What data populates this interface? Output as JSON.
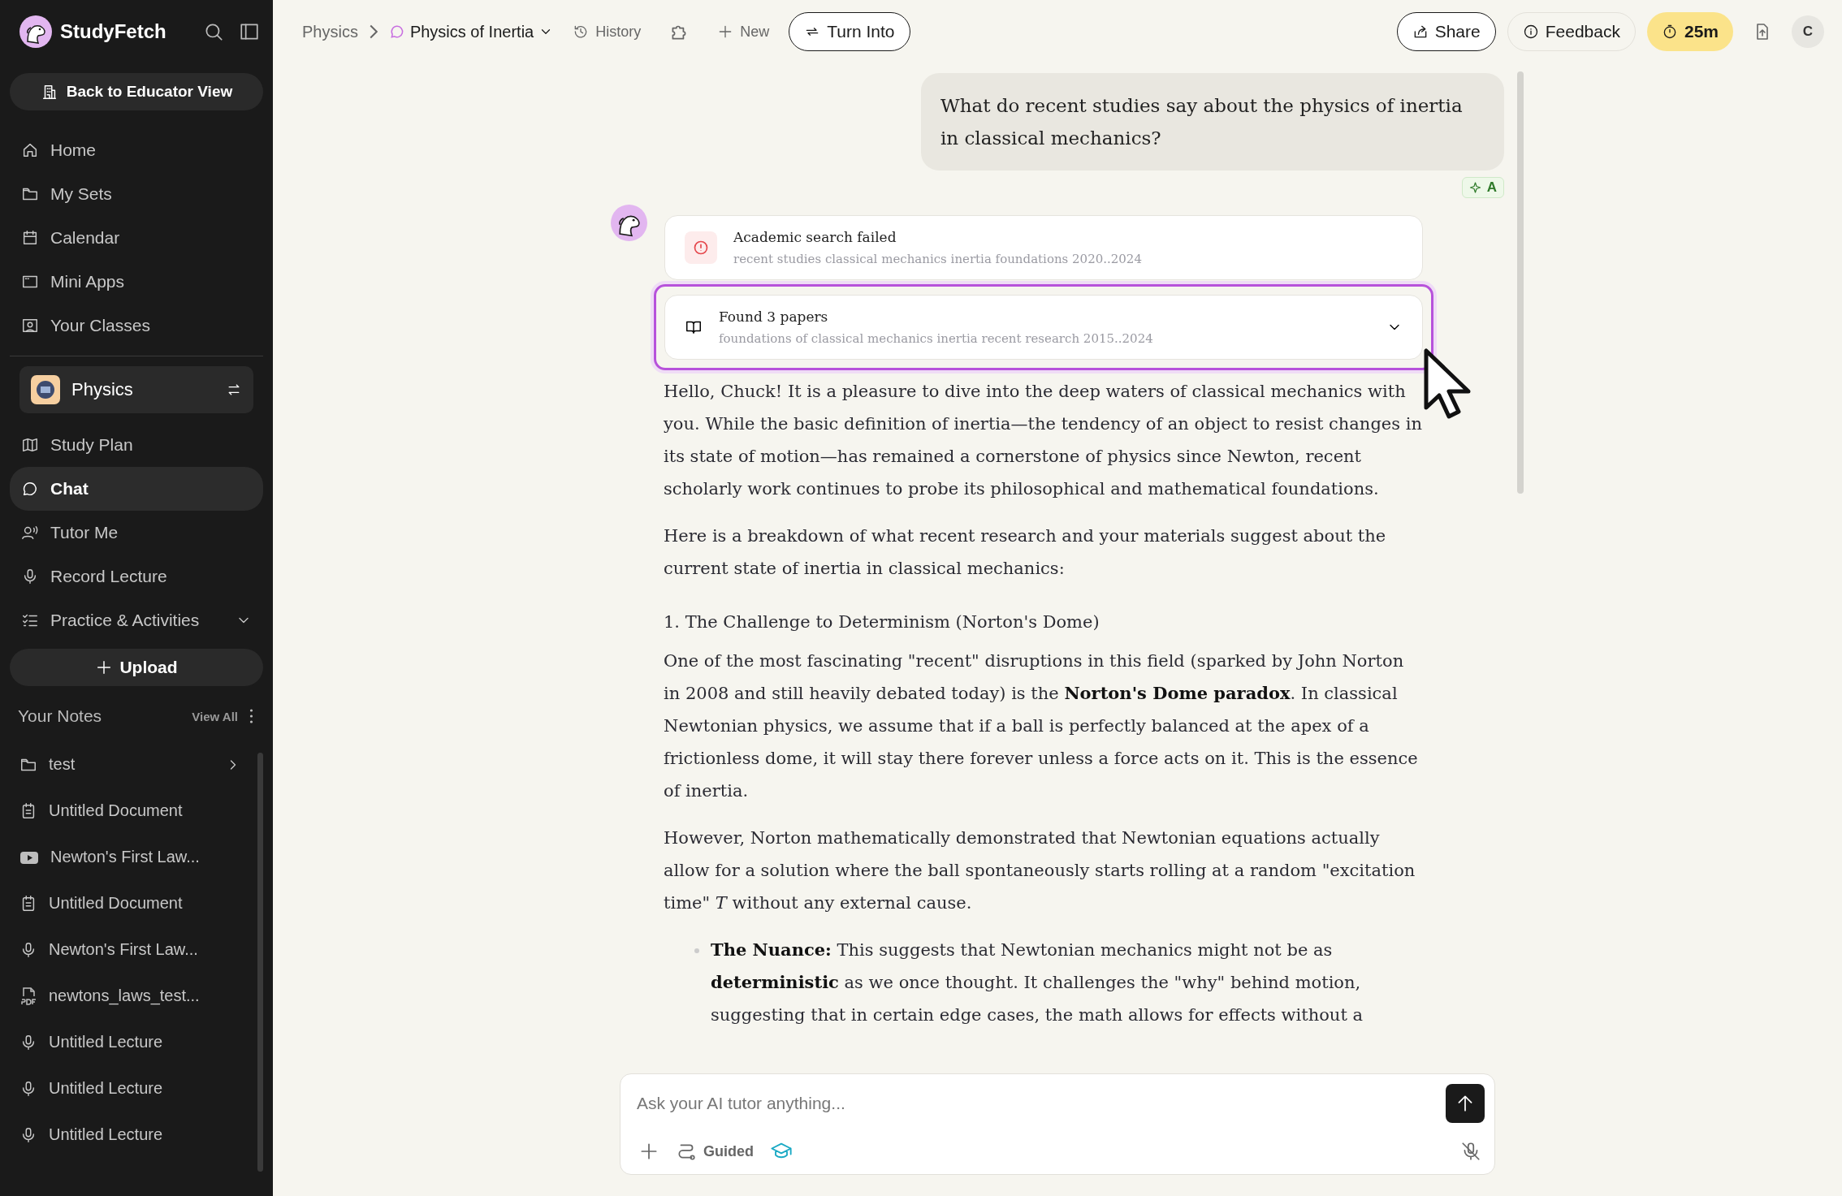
{
  "sidebar": {
    "brand": "StudyFetch",
    "educator_button": "Back to Educator View",
    "nav": [
      {
        "label": "Home"
      },
      {
        "label": "My Sets"
      },
      {
        "label": "Calendar"
      },
      {
        "label": "Mini Apps"
      },
      {
        "label": "Your Classes"
      }
    ],
    "class_name": "Physics",
    "class_nav": [
      {
        "label": "Study Plan",
        "selected": false,
        "has_menu": false
      },
      {
        "label": "Chat",
        "selected": true,
        "has_menu": false
      },
      {
        "label": "Tutor Me",
        "selected": false,
        "has_menu": false
      },
      {
        "label": "Record Lecture",
        "selected": false,
        "has_menu": false
      },
      {
        "label": "Practice & Activities",
        "selected": false,
        "has_menu": true
      }
    ],
    "upload": "Upload",
    "notes": {
      "title": "Your Notes",
      "view_all": "View All",
      "items": [
        {
          "kind": "folder",
          "label": "test"
        },
        {
          "kind": "document",
          "label": "Untitled Document"
        },
        {
          "kind": "video",
          "label": "Newton's First Law..."
        },
        {
          "kind": "document",
          "label": "Untitled Document"
        },
        {
          "kind": "audio",
          "label": "Newton's First Law..."
        },
        {
          "kind": "pdf",
          "label": "newtons_laws_test..."
        },
        {
          "kind": "audio",
          "label": "Untitled Lecture"
        },
        {
          "kind": "audio",
          "label": "Untitled Lecture"
        },
        {
          "kind": "audio",
          "label": "Untitled Lecture"
        }
      ]
    }
  },
  "topbar": {
    "breadcrumb": [
      "Physics",
      "Physics of Inertia"
    ],
    "history": "History",
    "new": "New",
    "turn_into": "Turn Into",
    "share": "Share",
    "feedback": "Feedback",
    "timer": "25m",
    "avatar": "C"
  },
  "chat": {
    "user_message": "What do recent studies say about the physics of inertia in classical mechanics?",
    "user_badge": "A",
    "tool_cards": [
      {
        "kind": "error",
        "title": "Academic search failed",
        "query": "recent studies classical mechanics inertia foundations 2020..2024",
        "selected": false
      },
      {
        "kind": "papers",
        "title": "Found 3 papers",
        "query": "foundations of classical mechanics inertia recent research 2015..2024",
        "selected": true
      }
    ],
    "blocks": [
      {
        "kind": "paragraph",
        "text": "Hello, Chuck! It is a pleasure to dive into the deep waters of classical mechanics with you. While the basic definition of inertia—the tendency of an object to resist changes in its state of motion—has remained a cornerstone of physics since Newton, recent scholarly work continues to probe its philosophical and mathematical foundations."
      },
      {
        "kind": "paragraph",
        "text": "Here is a breakdown of what recent research and your materials suggest about the current state of inertia in classical mechanics:"
      },
      {
        "kind": "heading",
        "text": "1. The Challenge to Determinism (Norton's Dome)"
      },
      {
        "kind": "paragraph",
        "text": "One of the most fascinating \"recent\" disruptions in this field (sparked by John Norton in 2008 and still heavily debated today) is the **Norton's Dome paradox**. In classical Newtonian physics, we assume that if a ball is perfectly balanced at the apex of a frictionless dome, it will stay there forever unless a force acts on it. This is the essence of inertia."
      },
      {
        "kind": "paragraph",
        "text": "However, Norton mathematically demonstrated that Newtonian equations actually allow for a solution where the ball spontaneously starts rolling at a random \"excitation time\" *T* without any external cause."
      },
      {
        "kind": "bullet",
        "text": "**The Nuance:** This suggests that Newtonian mechanics might not be as **deterministic** as we once thought. It challenges the \"why\" behind motion, suggesting that in certain edge cases, the math allows for effects without a"
      }
    ]
  },
  "composer": {
    "placeholder": "Ask your AI tutor anything...",
    "mode": "Guided"
  }
}
